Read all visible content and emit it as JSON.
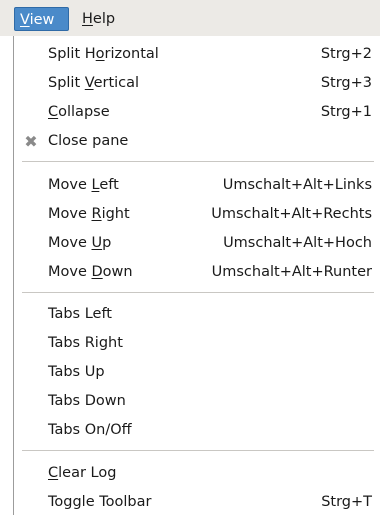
{
  "menubar": {
    "view": "View",
    "help": "Help",
    "view_bg": "#4a8ac9"
  },
  "menu": {
    "groups": [
      [
        {
          "label": "Split Horizontal",
          "accel": "Strg+2"
        },
        {
          "label": "Split Vertical",
          "accel": "Strg+3"
        },
        {
          "label": "Collapse",
          "accel": "Strg+1"
        },
        {
          "label": "Close pane",
          "accel": "",
          "icon": "close-x-icon"
        }
      ],
      [
        {
          "label": "Move Left",
          "accel": "Umschalt+Alt+Links"
        },
        {
          "label": "Move Right",
          "accel": "Umschalt+Alt+Rechts"
        },
        {
          "label": "Move Up",
          "accel": "Umschalt+Alt+Hoch"
        },
        {
          "label": "Move Down",
          "accel": "Umschalt+Alt+Runter"
        }
      ],
      [
        {
          "label": "Tabs Left",
          "accel": ""
        },
        {
          "label": "Tabs Right",
          "accel": ""
        },
        {
          "label": "Tabs Up",
          "accel": ""
        },
        {
          "label": "Tabs Down",
          "accel": ""
        },
        {
          "label": "Tabs On/Off",
          "accel": ""
        }
      ],
      [
        {
          "label": "Clear Log",
          "accel": ""
        },
        {
          "label": "Toggle Toolbar",
          "accel": "Strg+T"
        }
      ]
    ]
  }
}
